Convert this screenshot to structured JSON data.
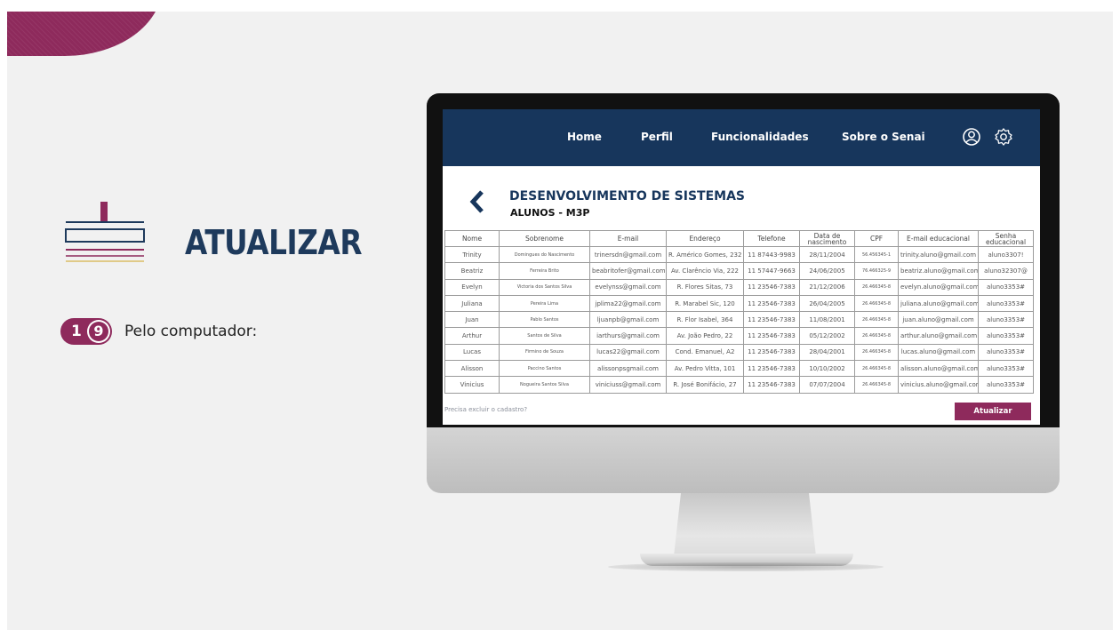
{
  "slide": {
    "title": "ATUALIZAR",
    "step_number_a": "1",
    "step_number_b": "9",
    "step_text": "Pelo computador:"
  },
  "colors": {
    "accent": "#8e2a5c",
    "navy": "#17365c",
    "title": "#1e3a5c"
  },
  "app": {
    "nav": {
      "home": "Home",
      "perfil": "Perfil",
      "funcionalidades": "Funcionalidades",
      "sobre": "Sobre o Senai",
      "user_icon": "user-circle-icon",
      "settings_icon": "gear-icon"
    },
    "page_title": "DESENVOLVIMENTO DE SISTEMAS",
    "page_subtitle": "ALUNOS - M3P",
    "back_icon": "chevron-left-icon",
    "table": {
      "headers": [
        "Nome",
        "Sobrenome",
        "E-mail",
        "Endereço",
        "Telefone",
        "Data de nascimento",
        "CPF",
        "E-mail educacional",
        "Senha educacional"
      ],
      "rows": [
        [
          "Trinity",
          "Domingues do Nascimento",
          "trinersdn@gmail.com",
          "R. Américo Gomes, 232",
          "11 87443-9983",
          "28/11/2004",
          "56.456345-1",
          "trinity.aluno@gmail.com",
          "aluno3307!"
        ],
        [
          "Beatriz",
          "Ferreira Brito",
          "beabritofer@gmail.com",
          "Av. Clarêncio Via, 222",
          "11 57447-9663",
          "24/06/2005",
          "76.466325-9",
          "beatriz.aluno@gmail.com",
          "aluno32307@"
        ],
        [
          "Evelyn",
          "Victoria dos Santos Silva",
          "evelynss@gmail.com",
          "R. Flores Sitas, 73",
          "11 23546-7383",
          "21/12/2006",
          "26.466345-8",
          "evelyn.aluno@gmail.com",
          "aluno3353#"
        ],
        [
          "Juliana",
          "Pereira Lima",
          "jplima22@gmail.com",
          "R. Marabel Sic, 120",
          "11 23546-7383",
          "26/04/2005",
          "26.466345-8",
          "juliana.aluno@gmail.com",
          "aluno3353#"
        ],
        [
          "Juan",
          "Pablo Santos",
          "ljuanpb@gmail.com",
          "R. Flor Isabel, 364",
          "11 23546-7383",
          "11/08/2001",
          "26.466345-8",
          "juan.aluno@gmail.com",
          "aluno3353#"
        ],
        [
          "Arthur",
          "Santos de Silva",
          "iarthurs@gmail.com",
          "Av. João Pedro, 22",
          "11 23546-7383",
          "05/12/2002",
          "26.466345-8",
          "arthur.aluno@gmail.com",
          "aluno3353#"
        ],
        [
          "Lucas",
          "Firmino de Souza",
          "lucas22@gmail.com",
          "Cond. Emanuel, A2",
          "11 23546-7383",
          "28/04/2001",
          "26.466345-8",
          "lucas.aluno@gmail.com",
          "aluno3353#"
        ],
        [
          "Alisson",
          "Paccino Santos",
          "alissonpsgmail.com",
          "Av. Pedro Vitta, 101",
          "11 23546-7383",
          "10/10/2002",
          "26.466345-8",
          "alisson.aluno@gmail.com",
          "aluno3353#"
        ],
        [
          "Vinicius",
          "Nogueira Santos Silva",
          "viniciuss@gmail.com",
          "R. José Bonifácio, 27",
          "11 23546-7383",
          "07/07/2004",
          "26.466345-8",
          "vinicius.aluno@gmail.com",
          "aluno3353#"
        ]
      ]
    },
    "delete_link": "Precisa excluir o cadastro?",
    "update_button": "Atualizar"
  }
}
